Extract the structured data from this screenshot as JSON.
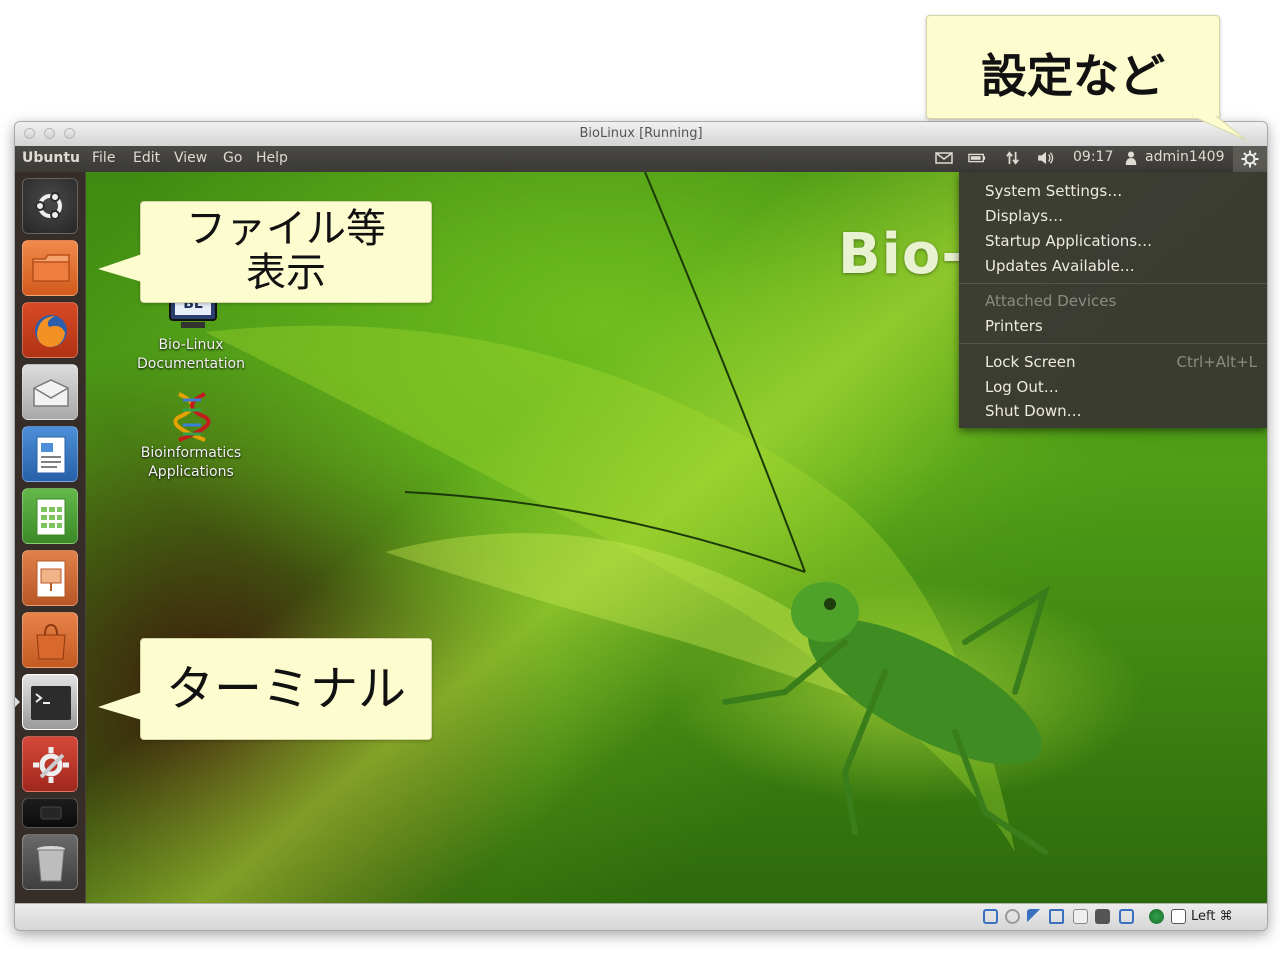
{
  "window": {
    "title": "BioLinux [Running]"
  },
  "top_panel": {
    "app_name": "Ubuntu",
    "menus": [
      "File",
      "Edit",
      "View",
      "Go",
      "Help"
    ],
    "clock": "09:17",
    "user": "admin1409"
  },
  "launcher": {
    "items": [
      {
        "name": "dash-home",
        "icon": "ubuntu-logo-icon"
      },
      {
        "name": "files",
        "icon": "folder-icon"
      },
      {
        "name": "firefox",
        "icon": "firefox-icon"
      },
      {
        "name": "mail",
        "icon": "mail-icon"
      },
      {
        "name": "writer",
        "icon": "document-icon"
      },
      {
        "name": "calc",
        "icon": "spreadsheet-icon"
      },
      {
        "name": "impress",
        "icon": "presentation-icon"
      },
      {
        "name": "software-center",
        "icon": "shopping-bag-icon"
      },
      {
        "name": "terminal",
        "icon": "terminal-icon"
      },
      {
        "name": "system-settings",
        "icon": "settings-icon"
      },
      {
        "name": "unknown-dark",
        "icon": "dark-app-icon"
      },
      {
        "name": "trash",
        "icon": "trash-icon"
      }
    ]
  },
  "desktop": {
    "logo_text": "Bio-",
    "icons": [
      {
        "label_line1": "Bio-Linux",
        "label_line2": "Documentation"
      },
      {
        "label_line1": "Bioinformatics",
        "label_line2": "Applications"
      }
    ]
  },
  "session_menu": {
    "items": [
      {
        "label": "System Settings…"
      },
      {
        "label": "Displays…"
      },
      {
        "label": "Startup Applications…"
      },
      {
        "label": "Updates Available…"
      },
      {
        "label": "Attached Devices"
      },
      {
        "label": "Printers"
      },
      {
        "label": "Lock Screen",
        "shortcut": "Ctrl+Alt+L"
      },
      {
        "label": "Log Out…"
      },
      {
        "label": "Shut Down…"
      }
    ]
  },
  "statusbar": {
    "host_key": "Left ⌘"
  },
  "callouts": {
    "settings": "設定など",
    "files_line1": "ファイル等",
    "files_line2": "表示",
    "terminal": "ターミナル"
  },
  "colors": {
    "panel": "#3c3b37",
    "menu_bg": "#3a3934",
    "callout_bg": "#fdfccf",
    "desktop_green": "#4e9e17"
  }
}
